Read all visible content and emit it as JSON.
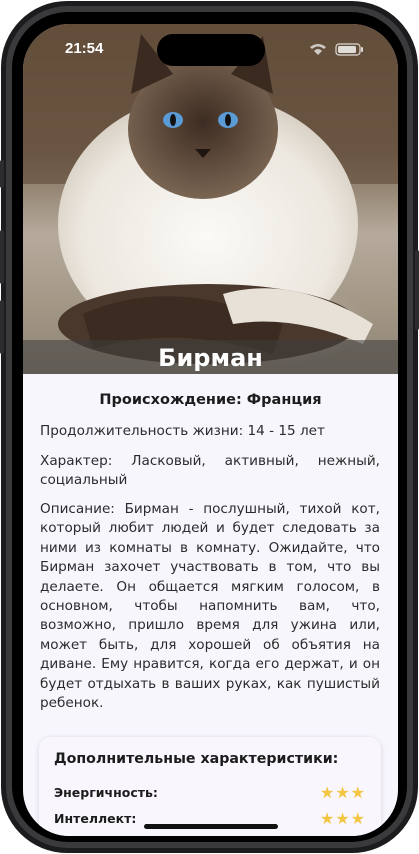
{
  "status_bar": {
    "time": "21:54"
  },
  "hero": {
    "title": "Бирман"
  },
  "details": {
    "origin": "Происхождение: Франция",
    "lifespan": "Продолжительность жизни: 14 - 15 лет",
    "temperament": "Характер: Ласковый, активный, нежный, социальный",
    "description": "Описание: Бирман - послушный, тихой кот, который любит людей и будет следовать за ними из комнаты в комнату. Ожидайте, что Бирман захочет участвовать в том, что вы делаете. Он общается мягким голосом, в основном, чтобы напомнить вам, что, возможно, пришло время для ужина или, может быть, для хорошей об объятия на диване. Ему нравится, когда его держат, и он будет отдыхать в ваших руках, как пушистый ребенок."
  },
  "characteristics": {
    "title": "Дополнительные характеристики:",
    "items": [
      {
        "label": "Энергичность:",
        "stars": "★★★",
        "rating": 3
      },
      {
        "label": "Интеллект:",
        "stars": "★★★",
        "rating": 3
      }
    ]
  },
  "colors": {
    "star": "#f4c542",
    "background": "#f8f6fd"
  }
}
